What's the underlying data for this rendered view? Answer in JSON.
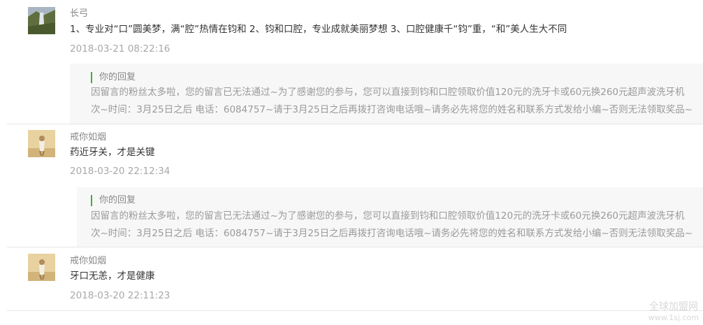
{
  "comments": [
    {
      "nickname": "长弓",
      "content": "1、专业对“口”圆美梦，满“腔”热情在钧和 2、钧和口腔，专业成就美丽梦想 3、口腔健康千“钧”重，“和”美人生大不同",
      "time": "2018-03-21 08:22:16",
      "reply_title": "你的回复",
      "reply_line1": "因留言的粉丝太多啦，您的留言已无法通过~为了感谢您的参与，您可以直接到钧和口腔领取价值120元的洗牙卡或60元换260元超声波洗牙机",
      "reply_line2": "次~时间：3月25日之后 电话：6084757~请于3月25日之后再拨打咨询电话哦~请务必先将您的姓名和联系方式发给小编~否则无法领取奖品~"
    },
    {
      "nickname": "戒你如烟",
      "content": "药近牙关，才是关键",
      "time": "2018-03-20 22:12:34",
      "reply_title": "你的回复",
      "reply_line1": "因留言的粉丝太多啦，您的留言已无法通过~为了感谢您的参与，您可以直接到钧和口腔领取价值120元的洗牙卡或60元换260元超声波洗牙机",
      "reply_line2": "次~时间：3月25日之后 电话：6084757~请于3月25日之后再拨打咨询电话哦~请务必先将您的姓名和联系方式发给小编~否则无法领取奖品~"
    },
    {
      "nickname": "戒你如烟",
      "content": "牙口无恙，才是健康",
      "time": "2018-03-20 22:11:23"
    }
  ],
  "watermark": {
    "line1": "全球加盟网",
    "line2": "www.1sj.com"
  }
}
